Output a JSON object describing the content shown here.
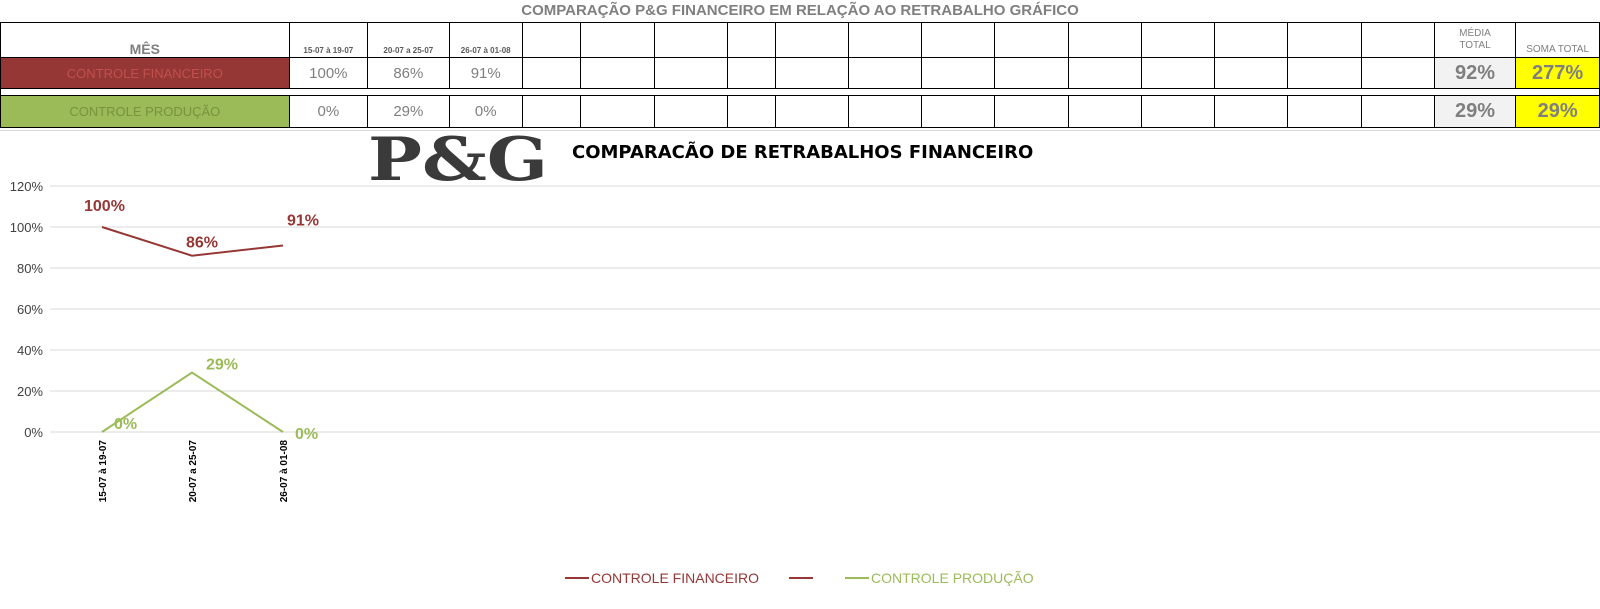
{
  "sheet": {
    "title": "COMPARAÇÃO P&G  FINANCEIRO EM RELAÇÃO AO RETRABALHO GRÁFICO",
    "mes_label": "MÊS",
    "weeks": [
      "15-07 à 19-07",
      "20-07 a 25-07",
      "26-07 à 01-08"
    ],
    "media_label_1": "MÉDIA",
    "media_label_2": "TOTAL",
    "soma_label": "SOMA TOTAL",
    "rows": [
      {
        "label": "CONTROLE FINANCEIRO",
        "values": [
          "100%",
          "86%",
          "91%"
        ],
        "media": "92%",
        "soma": "277%"
      },
      {
        "label": "CONTROLE PRODUÇÃO",
        "values": [
          "0%",
          "29%",
          "0%"
        ],
        "media": "29%",
        "soma": "29%"
      }
    ]
  },
  "logo_text": "P&G",
  "chart_data": {
    "type": "line",
    "title": "COMPARACÃO DE RETRABALHOS  FINANCEIRO",
    "categories": [
      "15-07 à 19-07",
      "20-07 a 25-07",
      "26-07 à 01-08"
    ],
    "series": [
      {
        "name": "CONTROLE FINANCEIRO",
        "values": [
          100,
          86,
          91
        ],
        "labels": [
          "100%",
          "86%",
          "91%"
        ],
        "color": "#953735"
      },
      {
        "name": "CONTROLE PRODUÇÃO",
        "values": [
          0,
          29,
          0
        ],
        "labels": [
          "0%",
          "29%",
          "0%"
        ],
        "color": "#9bbb59"
      }
    ],
    "ylim": [
      0,
      120
    ],
    "yticks": [
      "0%",
      "20%",
      "40%",
      "60%",
      "80%",
      "100%",
      "120%"
    ],
    "grid": true,
    "legend_position": "bottom"
  }
}
